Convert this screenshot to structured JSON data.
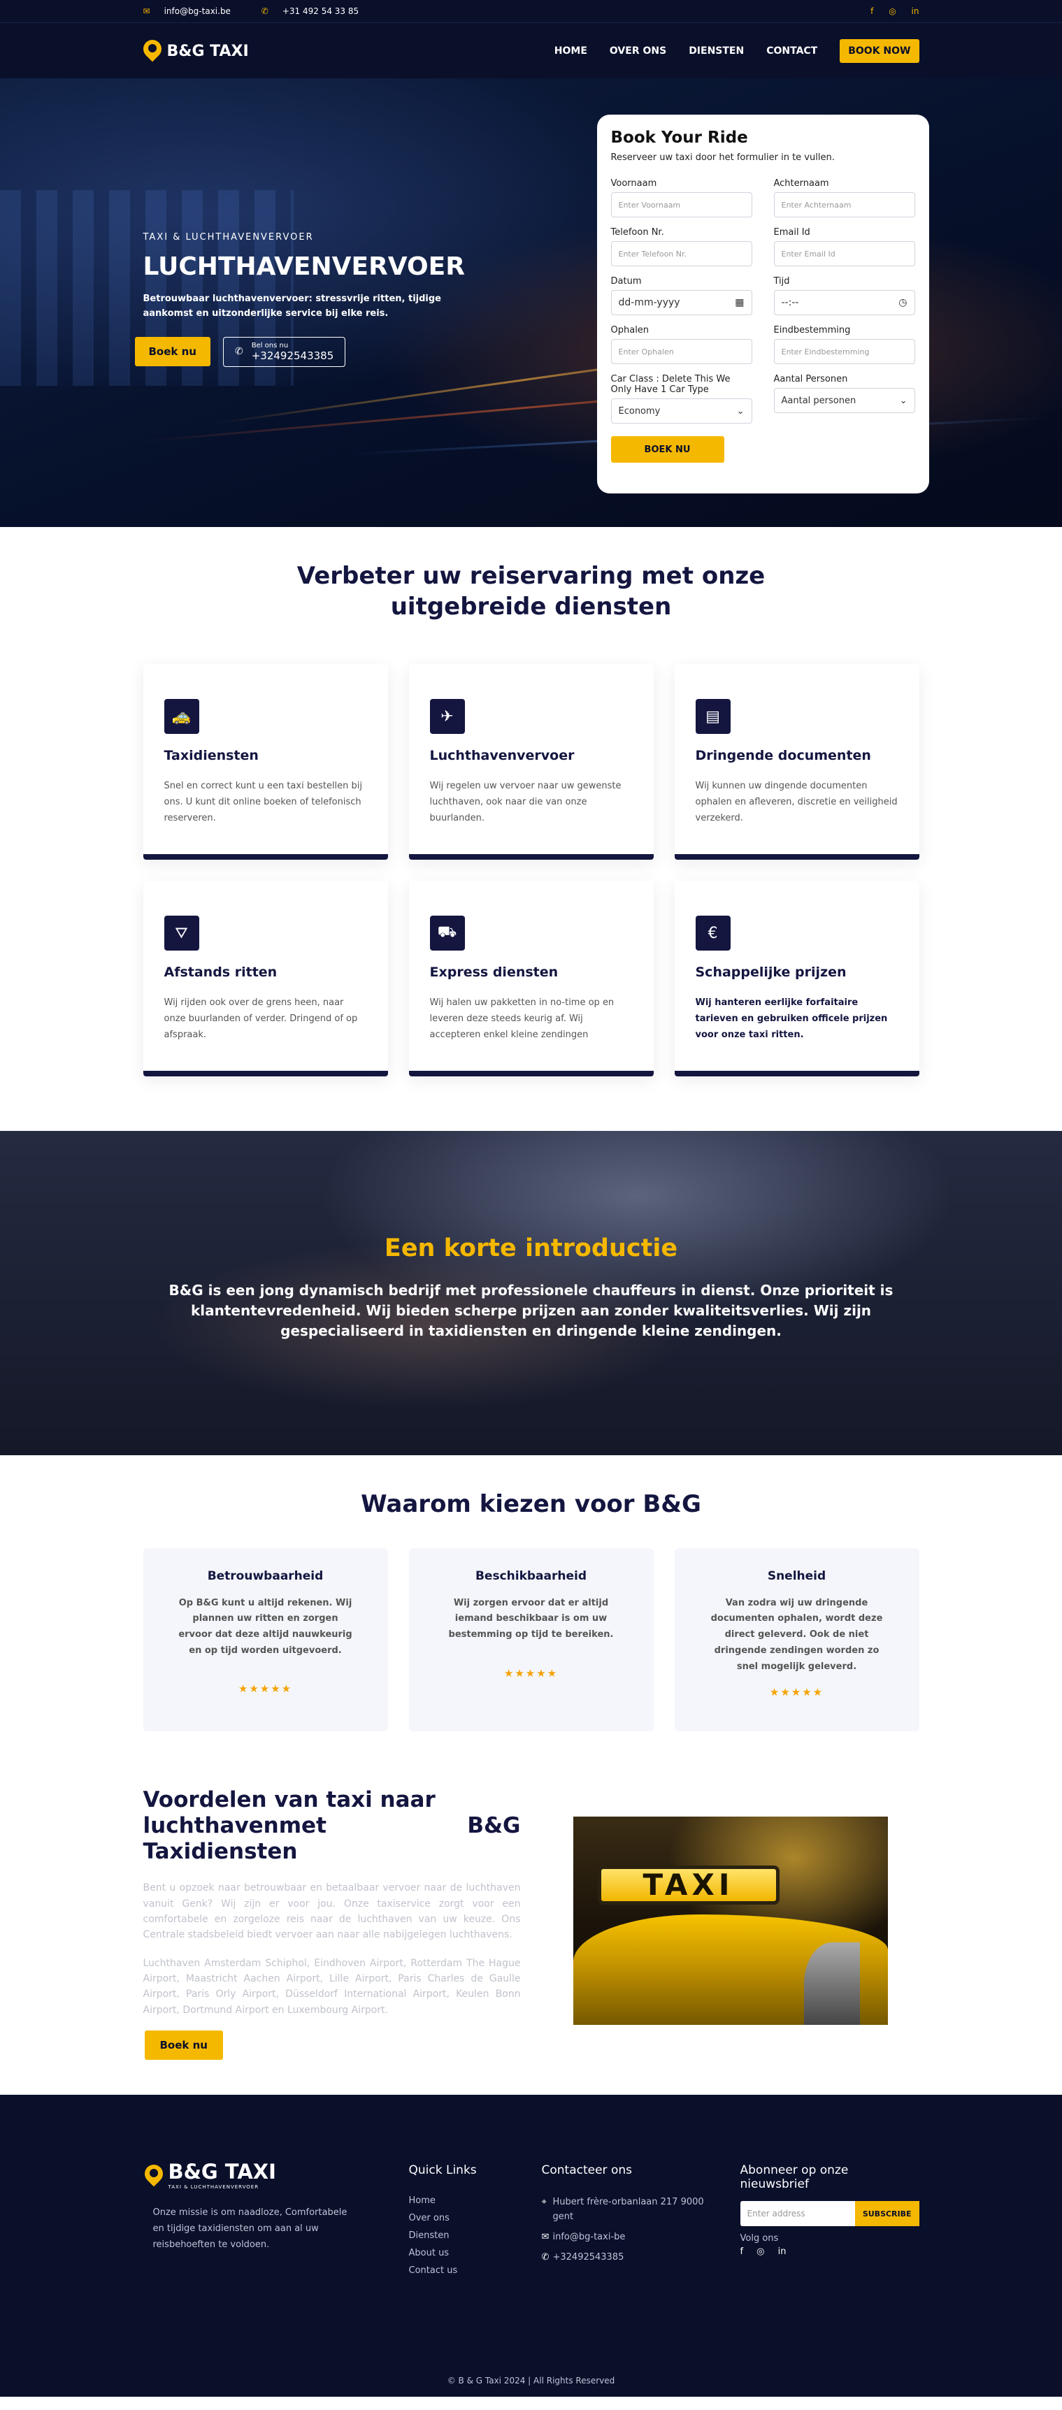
{
  "topbar": {
    "email": "info@bg-taxi.be",
    "phone": "+31 492 54 33 85",
    "socials": [
      "f",
      "◎",
      "in"
    ]
  },
  "nav": {
    "brand": "B&G TAXI",
    "items": [
      "HOME",
      "OVER ONS",
      "DIENSTEN",
      "CONTACT"
    ],
    "cta": "BOOK NOW"
  },
  "hero": {
    "eyebrow": "TAXI & LUCHTHAVENVERVOER",
    "title": "LUCHTHAVENVERVOER",
    "desc": "Betrouwbaar luchthavenvervoer: stressvrije ritten, tijdige aankomst en uitzonderlijke service bij elke reis.",
    "book_btn": "Boek nu",
    "call_small": "Bel ons nu",
    "call_number": "+32492543385"
  },
  "booking": {
    "title": "Book Your Ride",
    "subtitle": "Reserveer uw taxi door het formulier in te vullen.",
    "fields": [
      {
        "label": "Voornaam",
        "placeholder": "Enter Voornaam"
      },
      {
        "label": "Achternaam",
        "placeholder": "Enter Achternaam"
      },
      {
        "label": "Telefoon Nr.",
        "placeholder": "Enter Telefoon Nr."
      },
      {
        "label": "Email Id",
        "placeholder": "Enter Email Id"
      },
      {
        "label": "Datum",
        "placeholder": "dd-mm-yyyy"
      },
      {
        "label": "Tijd",
        "placeholder": "--:--"
      },
      {
        "label": "Ophalen",
        "placeholder": "Enter Ophalen"
      },
      {
        "label": "Eindbestemming",
        "placeholder": "Enter Eindbestemming"
      },
      {
        "label": "Car Class : Delete This We Only Have 1 Car Type",
        "placeholder": "Economy"
      },
      {
        "label": "Aantal Personen",
        "placeholder": "Aantal personen"
      }
    ],
    "submit": "BOEK NU"
  },
  "services": {
    "title_line1": "Verbeter uw reiservaring met onze",
    "title_line2": "uitgebreide diensten",
    "cards": [
      {
        "icon": "car-icon",
        "glyph": "🚕",
        "title": "Taxidiensten",
        "text": "Snel en correct kunt u een taxi bestellen bij ons. U kunt dit online boeken of telefonisch reserveren."
      },
      {
        "icon": "airplane-icon",
        "glyph": "✈",
        "title": "Luchthavenvervoer",
        "text": "Wij regelen uw vervoer naar uw gewenste luchthaven, ook naar die van onze buurlanden."
      },
      {
        "icon": "document-icon",
        "glyph": "▤",
        "title": "Dringende documenten",
        "text": "Wij kunnen uw dingende documenten ophalen en afleveren, discretie en veiligheid verzekerd."
      },
      {
        "icon": "road-icon",
        "glyph": "⛛",
        "title": "Afstands ritten",
        "text": "Wij rijden ook over de grens heen, naar onze buurlanden of verder. Dringend of op afspraak."
      },
      {
        "icon": "truck-icon",
        "glyph": "⛟",
        "title": "Express diensten",
        "text": "Wij halen uw pakketten in no-time op en leveren deze steeds keurig af. Wij accepteren enkel kleine zendingen"
      },
      {
        "icon": "euro-icon",
        "glyph": "€",
        "title": "Schappelijke prijzen",
        "text": "Wij hanteren eerlijke forfaitaire tarieven en gebruiken officele prijzen voor onze taxi ritten."
      }
    ]
  },
  "intro": {
    "title": "Een korte introductie",
    "text": "B&G is een jong dynamisch bedrijf met professionele chauffeurs in dienst. Onze prioriteit is klantentevredenheid. Wij bieden scherpe prijzen aan zonder kwaliteitsverlies. Wij zijn gespecialiseerd in taxidiensten en dringende kleine zendingen."
  },
  "why": {
    "title": "Waarom kiezen voor B&G",
    "cards": [
      {
        "title": "Betrouwbaarheid",
        "text": "Op B&G kunt u altijd rekenen. Wij plannen uw ritten en zorgen ervoor dat deze altijd nauwkeurig en op tijd worden uitgevoerd.",
        "stars": "★★★★★"
      },
      {
        "title": "Beschikbaarheid",
        "text": "Wij zorgen ervoor dat er altijd iemand beschikbaar is om uw bestemming op tijd te bereiken.",
        "stars": "★★★★★"
      },
      {
        "title": "Snelheid",
        "text": "Van zodra wij uw dringende documenten ophalen, wordt deze direct geleverd. Ook de niet dringende zendingen worden zo snel mogelijk geleverd.",
        "stars": "★★★★★"
      }
    ]
  },
  "benefits": {
    "title_left": "Voordelen van taxi naar luchthavenmet Taxidiensten",
    "title_right": "B&G",
    "para1": "Bent u opzoek naar betrouwbaar en betaalbaar vervoer naar de luchthaven vanuit Genk? Wij zijn er voor jou. Onze taxiservice zorgt voor een comfortabele en zorgeloze reis naar de luchthaven van uw keuze. Ons Centrale stadsbeleid biedt vervoer aan naar alle nabijgelegen luchthavens.",
    "para2": "Luchthaven Amsterdam Schiphol, Eindhoven Airport, Rotterdam The Hague Airport, Maastricht Aachen Airport, Lille Airport, Paris Charles de Gaulle Airport, Paris Orly Airport, Düsseldorf International Airport, Keulen Bonn Airport, Dortmund Airport en Luxembourg Airport.",
    "button": "Boek nu",
    "image_sign": "TAXI"
  },
  "footer": {
    "brand": "B&G TAXI",
    "brand_tag": "TAXI & LUCHTHAVENVERVOER",
    "mission": "Onze missie is om naadloze, Comfortabele en tijdige taxidiensten om aan al uw reisbehoeften te voldoen.",
    "quick_title": "Quick Links",
    "links": [
      "Home",
      "Over ons",
      "Diensten",
      "About us",
      "Contact us"
    ],
    "contact_title": "Contacteer ons",
    "address": "Hubert frère-orbanlaan 217 9000 gent",
    "email": "info@bg-taxi-be",
    "phone": "+32492543385",
    "newsletter_title": "Abonneer op onze nieuwsbrief",
    "email_placeholder": "Enter address",
    "subscribe": "SUBSCRIBE",
    "follow": "Volg ons",
    "socials": [
      "f",
      "◎",
      "in"
    ],
    "copyright": "© B & G Taxi 2024 | All Rights Reserved"
  }
}
